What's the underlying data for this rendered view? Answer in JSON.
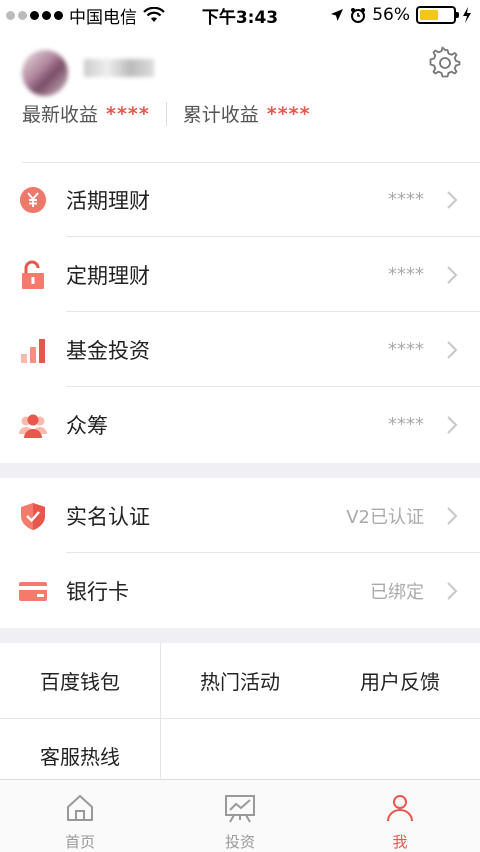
{
  "status_bar": {
    "carrier": "中国电信",
    "time": "下午3:43",
    "battery_pct": "56%",
    "battery_level": 0.56
  },
  "profile": {
    "latest_label": "最新收益",
    "latest_value": "****",
    "total_label": "累计收益",
    "total_value": "****"
  },
  "finance_items": [
    {
      "label": "活期理财",
      "value": "****",
      "icon": "yen-coin-icon"
    },
    {
      "label": "定期理财",
      "value": "****",
      "icon": "unlock-icon"
    },
    {
      "label": "基金投资",
      "value": "****",
      "icon": "bar-chart-icon"
    },
    {
      "label": "众筹",
      "value": "****",
      "icon": "people-icon"
    }
  ],
  "account_items": [
    {
      "label": "实名认证",
      "value": "V2已认证",
      "icon": "shield-check-icon"
    },
    {
      "label": "银行卡",
      "value": "已绑定",
      "icon": "bank-card-icon"
    }
  ],
  "grid": {
    "items": [
      "百度钱包",
      "热门活动",
      "用户反馈",
      "客服热线"
    ]
  },
  "tabbar": {
    "tabs": [
      {
        "label": "首页",
        "icon": "home-icon"
      },
      {
        "label": "投资",
        "icon": "chart-easel-icon"
      },
      {
        "label": "我",
        "icon": "person-icon"
      }
    ]
  },
  "colors": {
    "accent": "#e8574c",
    "icon_light": "#f7a08f",
    "section_gap": "#efeff4"
  }
}
